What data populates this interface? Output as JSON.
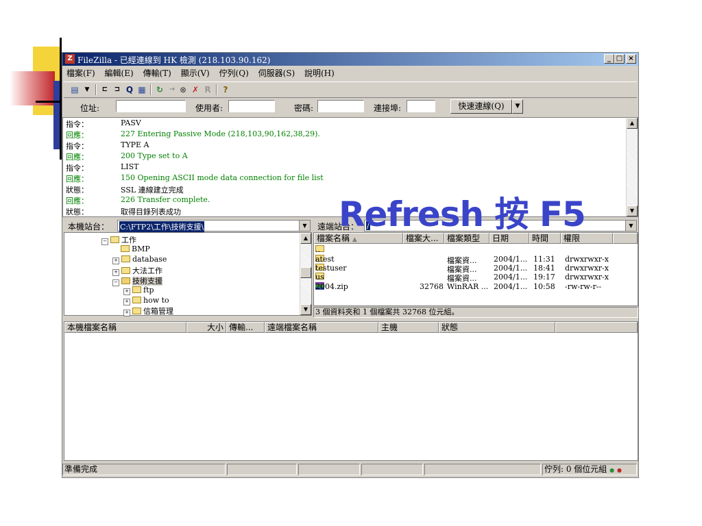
{
  "window": {
    "title": "FileZilla - 已經連線到 HK 檢測 (218.103.90.162)",
    "app_icon": "Z",
    "controls": {
      "minimize": "_",
      "maximize": "□",
      "close": "×"
    }
  },
  "menu": [
    "檔案(F)",
    "編輯(E)",
    "傳輸(T)",
    "顯示(V)",
    "佇列(Q)",
    "伺服器(S)",
    "說明(H)"
  ],
  "toolbar": {
    "icons": [
      "site-manager-icon",
      "dropdown-arrow-icon",
      "toggle-log-icon",
      "toggle-tree-icon",
      "search-icon",
      "queue-icon",
      "refresh-icon",
      "process-queue-icon",
      "cancel-icon",
      "disconnect-icon",
      "reconnect-icon",
      "help-icon"
    ]
  },
  "quickconnect": {
    "host_label": "位址:",
    "user_label": "使用者:",
    "pass_label": "密碼:",
    "port_label": "連接埠:",
    "button": "快速連線(Q)",
    "host_value": "",
    "user_value": "",
    "pass_value": "",
    "port_value": ""
  },
  "log": [
    {
      "kind": "指令：",
      "msg": "PASV",
      "type": "cmd"
    },
    {
      "kind": "回應：",
      "msg": "227 Entering Passive Mode (218,103,90,162,38,29).",
      "type": "resp"
    },
    {
      "kind": "指令：",
      "msg": "TYPE A",
      "type": "cmd"
    },
    {
      "kind": "回應：",
      "msg": "200 Type set to A",
      "type": "resp"
    },
    {
      "kind": "指令：",
      "msg": "LIST",
      "type": "cmd"
    },
    {
      "kind": "回應：",
      "msg": "150 Opening ASCII mode data connection for file list",
      "type": "resp"
    },
    {
      "kind": "狀態：",
      "msg": "SSL 連線建立完成",
      "type": "cmd"
    },
    {
      "kind": "回應：",
      "msg": "226 Transfer complete.",
      "type": "resp"
    },
    {
      "kind": "狀態：",
      "msg": "取得目錄列表成功",
      "type": "cmd"
    }
  ],
  "local": {
    "label": "本機站台：",
    "path": "C:\\FTP2\\工作\\技術支援\\",
    "tree": [
      {
        "name": "工作",
        "toggle": "-"
      },
      {
        "name": "BMP",
        "toggle": ""
      },
      {
        "name": "database",
        "toggle": "+"
      },
      {
        "name": "大法工作",
        "toggle": "+"
      },
      {
        "name": "技術支援",
        "toggle": "-"
      },
      {
        "name": "ftp",
        "toggle": "+"
      },
      {
        "name": "how to",
        "toggle": "+"
      },
      {
        "name": "信箱管理",
        "toggle": "+"
      }
    ]
  },
  "remote": {
    "label": "遠端站台：",
    "path": "/",
    "columns": [
      "檔案名稱",
      "檔案大...",
      "檔案類型",
      "日期",
      "時間",
      "權限"
    ],
    "files": [
      {
        "name": "..",
        "size": "",
        "type": "",
        "date": "",
        "time": "",
        "perm": "",
        "kind": "folder"
      },
      {
        "name": "atest",
        "size": "",
        "type": "檔案資...",
        "date": "2004/1...",
        "time": "11:31",
        "perm": "drwxrwxr-x",
        "kind": "folder"
      },
      {
        "name": "testuser",
        "size": "",
        "type": "檔案資...",
        "date": "2004/1...",
        "time": "18:41",
        "perm": "drwxrwxr-x",
        "kind": "folder"
      },
      {
        "name": "us",
        "size": "",
        "type": "檔案資...",
        "date": "2004/1...",
        "time": "19:17",
        "perm": "drwxrwxr-x",
        "kind": "folder"
      },
      {
        "name": "2004.zip",
        "size": "32768",
        "type": "WinRAR ...",
        "date": "2004/1...",
        "time": "10:58",
        "perm": "-rw-rw-r--",
        "kind": "rar"
      }
    ],
    "summary": "3 個資料夾和 1 個檔案共 32768 位元組。"
  },
  "queue": {
    "columns": [
      "本機檔案名稱",
      "大小",
      "傳輸...",
      "遠端檔案名稱",
      "主機",
      "狀態"
    ]
  },
  "statusbar": {
    "ready": "準備完成",
    "queue": "佇列: 0 個位元組"
  },
  "overlay_text": "Refresh 按 F5",
  "colors": {
    "overlay": "#3a44c8",
    "response": "#008000",
    "titlebar": "#0a246a"
  }
}
